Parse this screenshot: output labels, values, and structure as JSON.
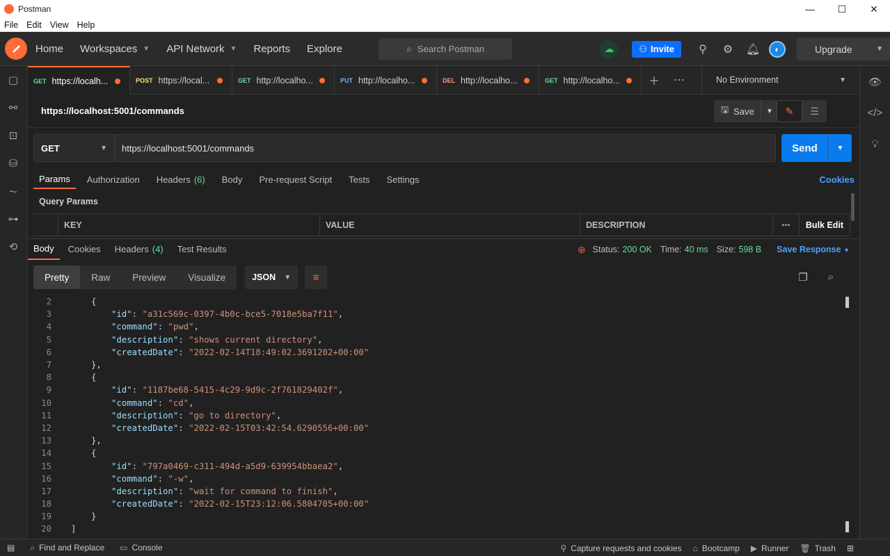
{
  "window": {
    "title": "Postman",
    "minimize": "—",
    "maximize": "☐",
    "close": "✕"
  },
  "menu": [
    "File",
    "Edit",
    "View",
    "Help"
  ],
  "header": {
    "nav": [
      {
        "label": "Home",
        "has_dropdown": false
      },
      {
        "label": "Workspaces",
        "has_dropdown": true
      },
      {
        "label": "API Network",
        "has_dropdown": true
      },
      {
        "label": "Reports",
        "has_dropdown": false
      },
      {
        "label": "Explore",
        "has_dropdown": false
      }
    ],
    "search_placeholder": "Search Postman",
    "invite_label": "Invite",
    "upgrade_label": "Upgrade"
  },
  "tabs": [
    {
      "method": "GET",
      "method_class": "m-get",
      "label": "https://localh...",
      "active": true
    },
    {
      "method": "POST",
      "method_class": "m-post",
      "label": "https://local...",
      "active": false
    },
    {
      "method": "GET",
      "method_class": "m-get",
      "label": "http://localho...",
      "active": false
    },
    {
      "method": "PUT",
      "method_class": "m-put",
      "label": "http://localho...",
      "active": false
    },
    {
      "method": "DEL",
      "method_class": "m-del",
      "label": "http://localho...",
      "active": false
    },
    {
      "method": "GET",
      "method_class": "m-get",
      "label": "http://localho...",
      "active": false
    }
  ],
  "environment": "No Environment",
  "request": {
    "title": "https://localhost:5001/commands",
    "save_label": "Save",
    "method": "GET",
    "url": "https://localhost:5001/commands",
    "send_label": "Send",
    "tabs": [
      {
        "label": "Params",
        "count": "",
        "active": true
      },
      {
        "label": "Authorization",
        "count": "",
        "active": false
      },
      {
        "label": "Headers",
        "count": "(6)",
        "active": false
      },
      {
        "label": "Body",
        "count": "",
        "active": false
      },
      {
        "label": "Pre-request Script",
        "count": "",
        "active": false
      },
      {
        "label": "Tests",
        "count": "",
        "active": false
      },
      {
        "label": "Settings",
        "count": "",
        "active": false
      }
    ],
    "cookies_link": "Cookies",
    "query_params_label": "Query Params",
    "table_headers": {
      "key": "KEY",
      "value": "VALUE",
      "description": "DESCRIPTION",
      "bulk_edit": "Bulk Edit"
    }
  },
  "response": {
    "tabs": [
      {
        "label": "Body",
        "count": "",
        "active": true
      },
      {
        "label": "Cookies",
        "count": "",
        "active": false
      },
      {
        "label": "Headers",
        "count": "(4)",
        "active": false
      },
      {
        "label": "Test Results",
        "count": "",
        "active": false
      }
    ],
    "status_label": "Status:",
    "status_value": "200 OK",
    "time_label": "Time:",
    "time_value": "40 ms",
    "size_label": "Size:",
    "size_value": "598 B",
    "save_response_label": "Save Response",
    "formats": [
      {
        "label": "Pretty",
        "active": true
      },
      {
        "label": "Raw",
        "active": false
      },
      {
        "label": "Preview",
        "active": false
      },
      {
        "label": "Visualize",
        "active": false
      }
    ],
    "language": "JSON",
    "lines": [
      {
        "n": "2",
        "indent": 1,
        "parts": [
          [
            "p",
            "{"
          ]
        ]
      },
      {
        "n": "3",
        "indent": 2,
        "parts": [
          [
            "k",
            "\"id\""
          ],
          [
            "p",
            ": "
          ],
          [
            "s",
            "\"a31c569c-0397-4b0c-bce5-7018e5ba7f11\""
          ],
          [
            "p",
            ","
          ]
        ]
      },
      {
        "n": "4",
        "indent": 2,
        "parts": [
          [
            "k",
            "\"command\""
          ],
          [
            "p",
            ": "
          ],
          [
            "s",
            "\"pwd\""
          ],
          [
            "p",
            ","
          ]
        ]
      },
      {
        "n": "5",
        "indent": 2,
        "parts": [
          [
            "k",
            "\"description\""
          ],
          [
            "p",
            ": "
          ],
          [
            "s",
            "\"shows current directory\""
          ],
          [
            "p",
            ","
          ]
        ]
      },
      {
        "n": "6",
        "indent": 2,
        "parts": [
          [
            "k",
            "\"createdDate\""
          ],
          [
            "p",
            ": "
          ],
          [
            "s",
            "\"2022-02-14T18:49:02.3691202+00:00\""
          ]
        ]
      },
      {
        "n": "7",
        "indent": 1,
        "parts": [
          [
            "p",
            "},"
          ]
        ]
      },
      {
        "n": "8",
        "indent": 1,
        "parts": [
          [
            "p",
            "{"
          ]
        ]
      },
      {
        "n": "9",
        "indent": 2,
        "parts": [
          [
            "k",
            "\"id\""
          ],
          [
            "p",
            ": "
          ],
          [
            "s",
            "\"1187be68-5415-4c29-9d9c-2f761829402f\""
          ],
          [
            "p",
            ","
          ]
        ]
      },
      {
        "n": "10",
        "indent": 2,
        "parts": [
          [
            "k",
            "\"command\""
          ],
          [
            "p",
            ": "
          ],
          [
            "s",
            "\"cd\""
          ],
          [
            "p",
            ","
          ]
        ]
      },
      {
        "n": "11",
        "indent": 2,
        "parts": [
          [
            "k",
            "\"description\""
          ],
          [
            "p",
            ": "
          ],
          [
            "s",
            "\"go to directory\""
          ],
          [
            "p",
            ","
          ]
        ]
      },
      {
        "n": "12",
        "indent": 2,
        "parts": [
          [
            "k",
            "\"createdDate\""
          ],
          [
            "p",
            ": "
          ],
          [
            "s",
            "\"2022-02-15T03:42:54.6290556+00:00\""
          ]
        ]
      },
      {
        "n": "13",
        "indent": 1,
        "parts": [
          [
            "p",
            "},"
          ]
        ]
      },
      {
        "n": "14",
        "indent": 1,
        "parts": [
          [
            "p",
            "{"
          ]
        ]
      },
      {
        "n": "15",
        "indent": 2,
        "parts": [
          [
            "k",
            "\"id\""
          ],
          [
            "p",
            ": "
          ],
          [
            "s",
            "\"797a0469-c311-494d-a5d9-639954bbaea2\""
          ],
          [
            "p",
            ","
          ]
        ]
      },
      {
        "n": "16",
        "indent": 2,
        "parts": [
          [
            "k",
            "\"command\""
          ],
          [
            "p",
            ": "
          ],
          [
            "s",
            "\"-w\""
          ],
          [
            "p",
            ","
          ]
        ]
      },
      {
        "n": "17",
        "indent": 2,
        "parts": [
          [
            "k",
            "\"description\""
          ],
          [
            "p",
            ": "
          ],
          [
            "s",
            "\"wait for command to finish\""
          ],
          [
            "p",
            ","
          ]
        ]
      },
      {
        "n": "18",
        "indent": 2,
        "parts": [
          [
            "k",
            "\"createdDate\""
          ],
          [
            "p",
            ": "
          ],
          [
            "s",
            "\"2022-02-15T23:12:06.5804705+00:00\""
          ]
        ]
      },
      {
        "n": "19",
        "indent": 1,
        "parts": [
          [
            "p",
            "}"
          ]
        ]
      },
      {
        "n": "20",
        "indent": 0,
        "parts": [
          [
            "p",
            "]"
          ]
        ]
      }
    ]
  },
  "statusbar": {
    "find_replace": "Find and Replace",
    "console": "Console",
    "capture": "Capture requests and cookies",
    "bootcamp": "Bootcamp",
    "runner": "Runner",
    "trash": "Trash"
  },
  "colors": {
    "accent": "#ff6c37",
    "send": "#097bed",
    "success": "#6bdd9a",
    "link": "#4aa3ff"
  }
}
